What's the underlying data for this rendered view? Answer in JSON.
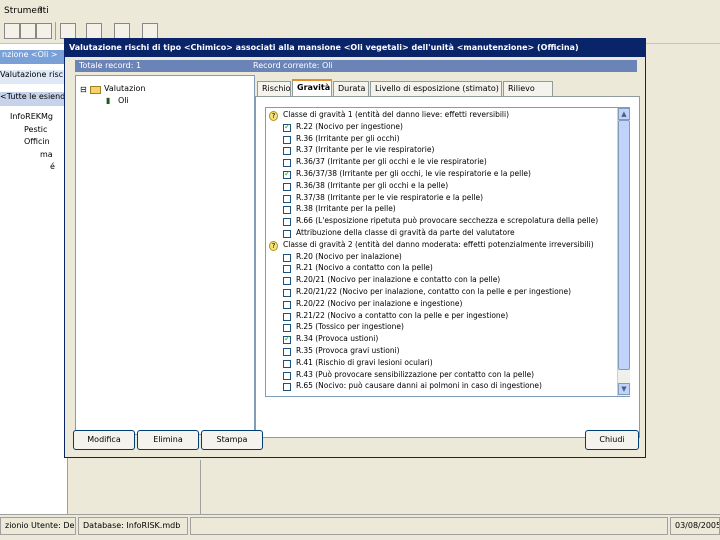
{
  "bg": {
    "menu": [
      "Strumenti",
      "?"
    ],
    "left_title": "nzione <Oli >",
    "left_rows": [
      "Valutazione risc",
      "<Tutte le esiend"
    ],
    "tree": [
      "InfoREKMg",
      "Pestic",
      "Officin",
      "ma",
      "é"
    ],
    "status_user": "zionio  Utente: Demo",
    "status_db": "Database: InfoRISK.mdb",
    "status_date": "03/08/2005"
  },
  "dialog": {
    "title": "Valutazione rischi di tipo <Chimico> associati alla mansione <Oli vegetali> dell'unità <manutenzione> (Officina)",
    "total_record": "Totale record: 1",
    "current_record": "Record corrente: Oli",
    "tree_root": "Valutazion",
    "tree_child": "Oli",
    "tabs": [
      "Rischio",
      "Gravità",
      "Durata",
      "Livello di esposizione (stimato)",
      "Rilievo"
    ],
    "rows": [
      {
        "type": "header",
        "label": "Classe di gravità 1 (entità del danno lieve: effetti reversibili)"
      },
      {
        "type": "item",
        "checked": true,
        "label": "R.22 (Nocivo per ingestione)"
      },
      {
        "type": "item",
        "checked": false,
        "label": "R.36 (Irritante per gli occhi)"
      },
      {
        "type": "item",
        "checked": false,
        "label": "R.37 (Irritante per le vie respiratorie)"
      },
      {
        "type": "item",
        "checked": false,
        "label": "R.36/37 (Irritante per gli occhi e le vie respiratorie)"
      },
      {
        "type": "item",
        "checked": true,
        "label": "R.36/37/38 (Irritante per gli occhi, le vie respiratorie e la pelle)"
      },
      {
        "type": "item",
        "checked": false,
        "label": "R.36/38 (Irritante per gli occhi e la pelle)"
      },
      {
        "type": "item",
        "checked": false,
        "label": "R.37/38 (Irritante per le vie respiratorie e la pelle)"
      },
      {
        "type": "item",
        "checked": false,
        "label": "R.38 (Irritante per la pelle)"
      },
      {
        "type": "item",
        "checked": false,
        "label": "R.66 (L'esposizione ripetuta può provocare secchezza e screpolatura della pelle)"
      },
      {
        "type": "item",
        "checked": false,
        "label": "Attribuzione della classe di gravità da parte del valutatore"
      },
      {
        "type": "header",
        "label": "Classe di gravità 2 (entità del danno moderata: effetti potenzialmente irreversibili)"
      },
      {
        "type": "item",
        "checked": false,
        "label": "R.20 (Nocivo per inalazione)"
      },
      {
        "type": "item",
        "checked": false,
        "label": "R.21 (Nocivo a contatto con la pelle)"
      },
      {
        "type": "item",
        "checked": false,
        "label": "R.20/21 (Nocivo per inalazione e contatto con la pelle)"
      },
      {
        "type": "item",
        "checked": false,
        "label": "R.20/21/22 (Nocivo per inalazione, contatto con la pelle e per ingestione)"
      },
      {
        "type": "item",
        "checked": false,
        "label": "R.20/22 (Nocivo per inalazione e ingestione)"
      },
      {
        "type": "item",
        "checked": false,
        "label": "R.21/22 (Nocivo a contatto con la pelle e per ingestione)"
      },
      {
        "type": "item",
        "checked": false,
        "label": "R.25 (Tossico per ingestione)"
      },
      {
        "type": "item",
        "checked": true,
        "label": "R.34 (Provoca ustioni)"
      },
      {
        "type": "item",
        "checked": false,
        "label": "R.35 (Provoca gravi ustioni)"
      },
      {
        "type": "item",
        "checked": false,
        "label": "R.41 (Rischio di gravi lesioni oculari)"
      },
      {
        "type": "item",
        "checked": false,
        "label": "R.43 (Può provocare sensibilizzazione per contatto con la pelle)"
      },
      {
        "type": "item",
        "checked": false,
        "label": "R.65 (Nocivo: può causare danni ai polmoni in caso di ingestione)"
      }
    ],
    "buttons": {
      "edit": "Modifica",
      "delete": "Elimina",
      "print": "Stampa",
      "close": "Chiudi"
    }
  }
}
